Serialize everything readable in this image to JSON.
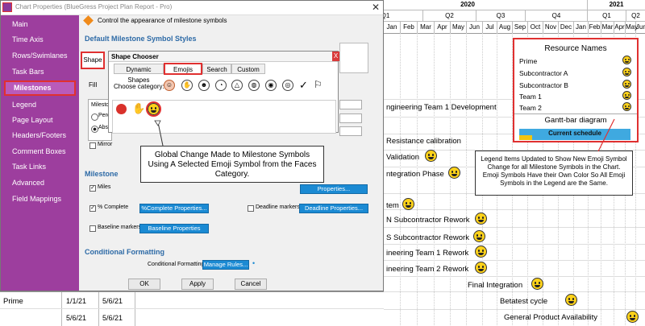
{
  "gantt": {
    "years": [
      "2020",
      "2021"
    ],
    "quarters": [
      "Q1",
      "Q2",
      "Q3",
      "Q4",
      "Q1",
      "Q2"
    ],
    "months": [
      "Jan",
      "Feb",
      "Mar",
      "Apr",
      "May",
      "Jun",
      "Jul",
      "Aug",
      "Sep",
      "Oct",
      "Nov",
      "Dec",
      "Jan",
      "Feb",
      "Mar",
      "Apr",
      "May",
      "Jun"
    ],
    "tasks": [
      {
        "label": "ngineering Team 1 Development"
      },
      {
        "label": "Resistance calibration"
      },
      {
        "label": "Validation"
      },
      {
        "label": "ntegration Phase"
      },
      {
        "label": "tem"
      },
      {
        "label": "N Subcontractor Rework"
      },
      {
        "label": "S Subcontractor Rework"
      },
      {
        "label": "ineering Team 1 Rework"
      },
      {
        "label": "ineering Team 2 Rework"
      },
      {
        "label": "Final Integration"
      },
      {
        "label": "Betatest cycle"
      },
      {
        "label": "General Product Availability"
      }
    ],
    "bottom_rows": [
      {
        "name": "Prime",
        "start": "1/1/21",
        "end": "5/6/21"
      },
      {
        "name": "",
        "start": "5/6/21",
        "end": "5/6/21"
      }
    ],
    "legend": {
      "title": "Resource Names",
      "items": [
        "Prime",
        "Subcontractor A",
        "Subcontractor B",
        "Team 1",
        "Team 2"
      ],
      "gantt_title": "Gantt-bar diagram",
      "current_schedule": "Current schedule"
    }
  },
  "dialog": {
    "title": "Chart Properties (BlueGress Project Plan Report - Pro)",
    "subtitle": "Control the appearance of milestone symbols",
    "sidebar": [
      "Main",
      "Time Axis",
      "Rows/Swimlanes",
      "Task Bars",
      "Milestones",
      "Legend",
      "Page Layout",
      "Headers/Footers",
      "Comment Boxes",
      "Task Links",
      "Advanced",
      "Field Mappings"
    ],
    "section_default": "Default Milestone Symbol Styles",
    "shape_label": "Shape",
    "fill_label": "Fill",
    "milestone_label": "Milesto",
    "perc_label": "Perc",
    "abs_label": "Abs",
    "mirror_label": "Mirror",
    "section_milestone": "Milestone",
    "miles_label": "Miles",
    "pct_complete_label": "% Complete",
    "pct_complete_btn": "%Complete Properties...",
    "deadline_label": "Deadline markers",
    "deadline_btn": "Deadline Properties...",
    "baseline_label": "Baseline markers",
    "baseline_btn": "Baseline Properties",
    "cond_title": "Conditional Formatting",
    "cond_label": "Conditional Formatting",
    "manage_btn": "Manage Rules...",
    "ok": "OK",
    "apply": "Apply",
    "cancel": "Cancel",
    "props_btn": "Properties..."
  },
  "shape_chooser": {
    "title": "Shape Chooser",
    "close": "X",
    "tabs": [
      "Dynamic Shapes",
      "Emojis",
      "Search",
      "Custom"
    ],
    "category_label": "Choose category:"
  },
  "annotations": {
    "left": "Global Change Made to Milestone Symbols Using A Selected Emoji Symbol from the Faces Category.",
    "right": "Legend Items Updated to Show New Emoji Symbol Change for all Milestone Symbols in the Chart.  Emoji Symbols Have their Own Color So All Emoji Symbols in the Legend are the Same."
  },
  "colors": {
    "sidebar": "#9d3e9e",
    "accent": "#e03030",
    "button_blue": "#1b8ad3",
    "section_title": "#2d6aa6",
    "emoji": "#ffd21a"
  }
}
